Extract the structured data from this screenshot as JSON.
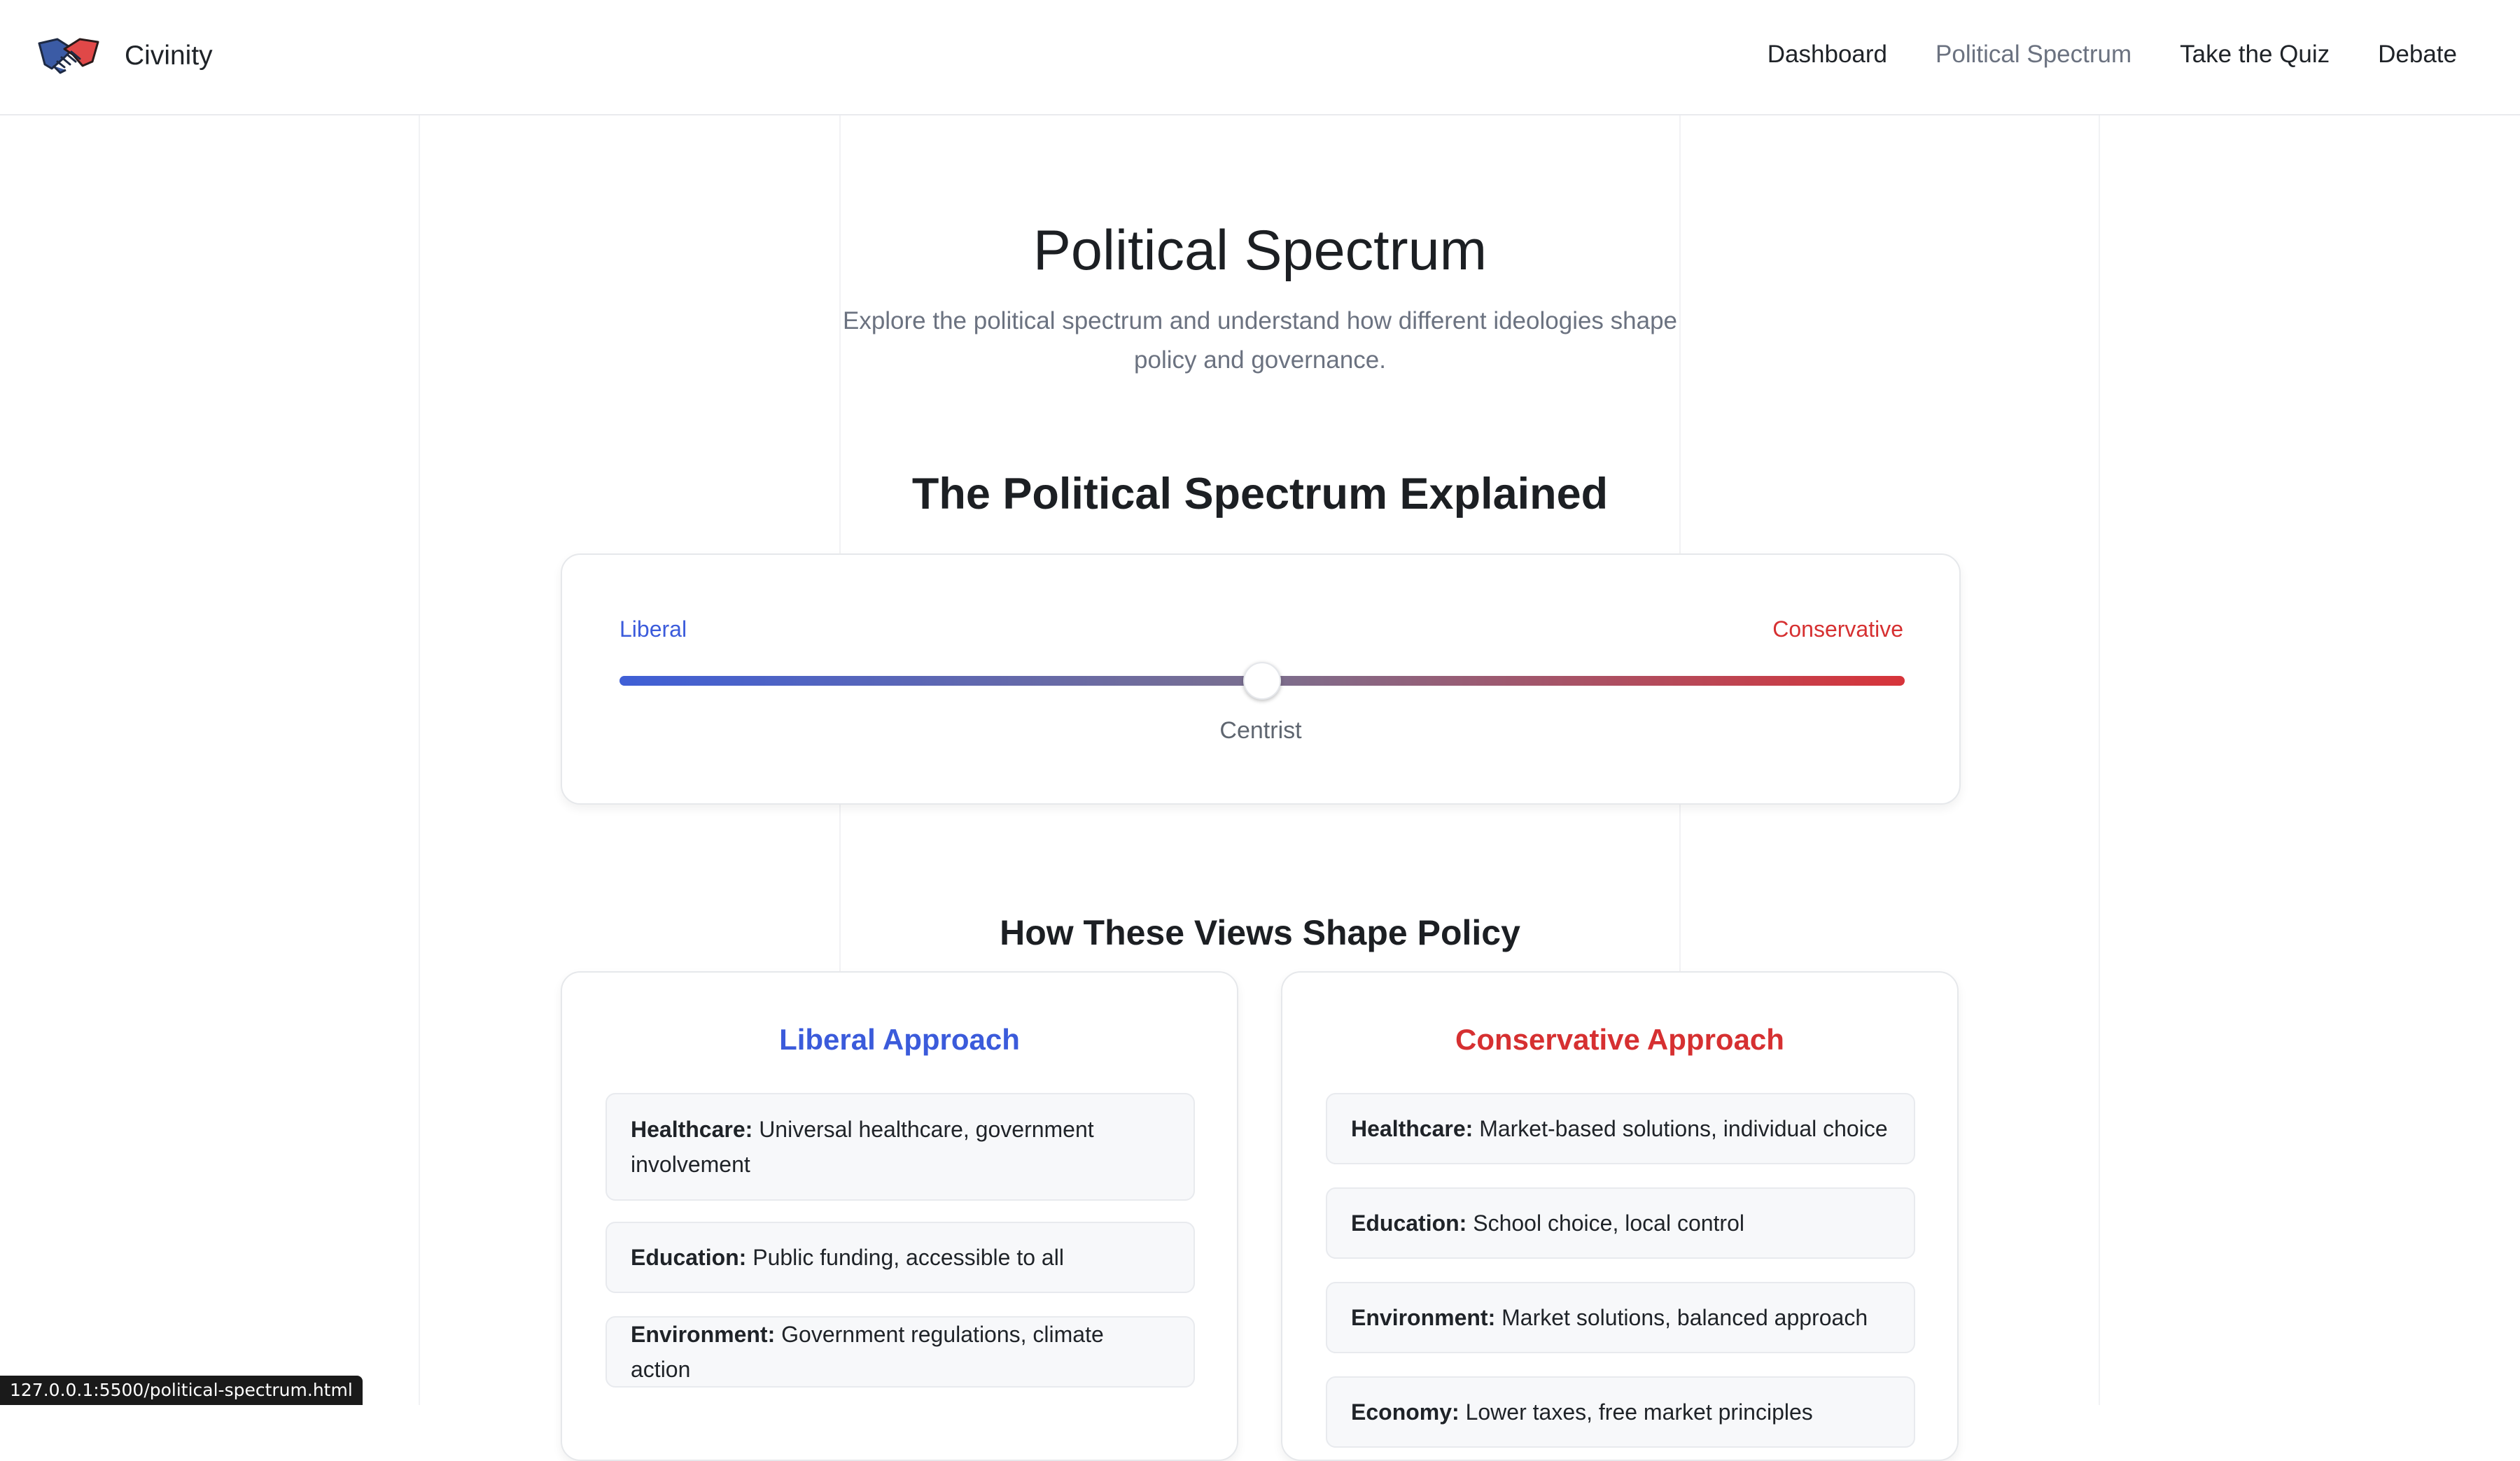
{
  "brand": {
    "name": "Civinity",
    "logo_icon": "handshake-icon",
    "colors": {
      "blue": "#3b5ba5",
      "red": "#e04848"
    }
  },
  "nav": {
    "items": [
      {
        "label": "Dashboard",
        "active": false
      },
      {
        "label": "Political Spectrum",
        "active": true
      },
      {
        "label": "Take the Quiz",
        "active": false
      },
      {
        "label": "Debate",
        "active": false
      }
    ]
  },
  "hero": {
    "title": "Political Spectrum",
    "subtitle": "Explore the political spectrum and understand how different ideologies shape policy and governance."
  },
  "spectrum": {
    "section_title": "The Political Spectrum Explained",
    "left_label": "Liberal",
    "right_label": "Conservative",
    "position_label": "Centrist",
    "slider_value_percent": 50,
    "colors": {
      "liberal": "#3b5bdb",
      "conservative": "#d63031"
    }
  },
  "policy": {
    "section_title": "How These Views Shape Policy",
    "liberal": {
      "title": "Liberal Approach",
      "items": [
        {
          "topic": "Healthcare:",
          "text": "Universal healthcare, government involvement"
        },
        {
          "topic": "Education:",
          "text": "Public funding, accessible to all"
        },
        {
          "topic": "Environment:",
          "text": "Government regulations, climate action"
        }
      ]
    },
    "conservative": {
      "title": "Conservative Approach",
      "items": [
        {
          "topic": "Healthcare:",
          "text": "Market-based solutions, individual choice"
        },
        {
          "topic": "Education:",
          "text": "School choice, local control"
        },
        {
          "topic": "Environment:",
          "text": "Market solutions, balanced approach"
        },
        {
          "topic": "Economy:",
          "text": "Lower taxes, free market principles"
        }
      ]
    }
  },
  "status_bar": {
    "url": "127.0.0.1:5500/political-spectrum.html"
  }
}
